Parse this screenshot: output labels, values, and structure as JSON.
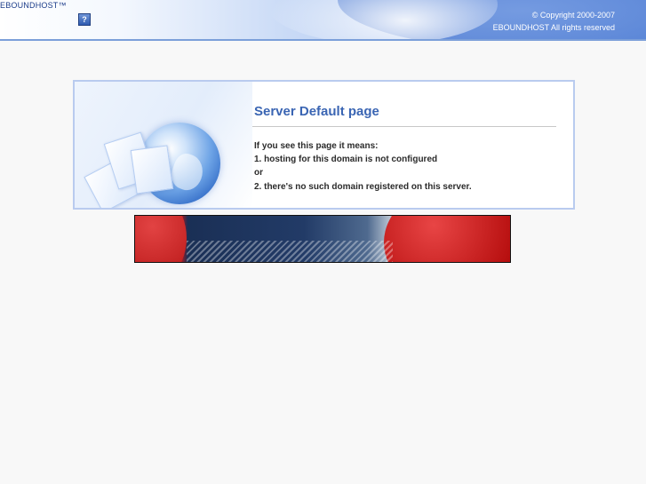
{
  "header": {
    "brand": "EBOUNDHOST™",
    "help_label": "?",
    "copyright_line1": "© Copyright 2000-2007",
    "copyright_line2": "EBOUNDHOST All rights reserved"
  },
  "panel": {
    "title": "Server Default page",
    "lines": [
      "If you see this page it means:",
      "1. hosting for this domain is not configured",
      "or",
      "2. there's no such domain registered on this server."
    ]
  }
}
